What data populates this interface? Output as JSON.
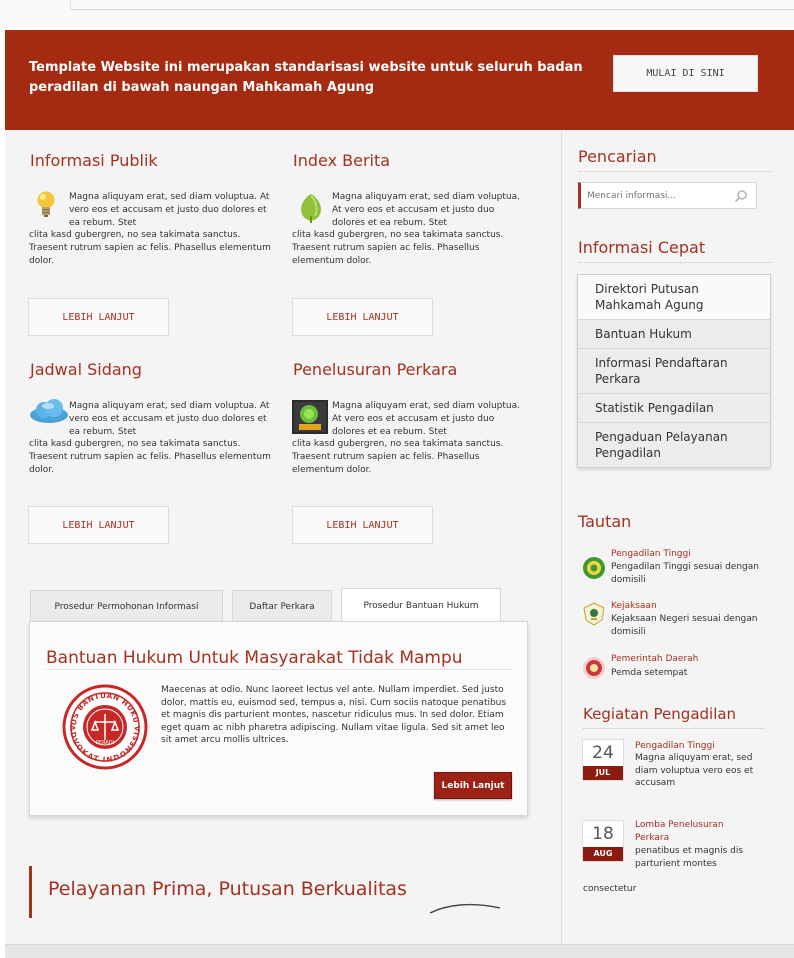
{
  "banner": {
    "text": "Template Website ini merupakan standarisasi website untuk seluruh badan peradilan di bawah naungan Mahkamah Agung",
    "button_label": "MULAI DI SINI"
  },
  "sections": [
    {
      "title": "Informasi Publik",
      "icon": "lightbulb-icon",
      "text_indent": "Magna aliquyam erat, sed diam voluptua. At vero eos et accusam et justo duo dolores et ea rebum. Stet",
      "text_rest": "clita kasd gubergren, no sea takimata sanctus. Traesent rutrum sapien ac felis. Phasellus elementum dolor.",
      "button_label": "LEBIH LANJUT"
    },
    {
      "title": "Index Berita",
      "icon": "leaf-icon",
      "text_indent": "Magna aliquyam erat, sed diam voluptua. At vero eos et accusam et justo duo dolores et ea rebum. Stet",
      "text_rest": "clita kasd gubergren, no sea takimata sanctus. Traesent rutrum sapien ac felis. Phasellus elementum dolor.",
      "button_label": "LEBIH LANJUT"
    },
    {
      "title": "Jadwal Sidang",
      "icon": "cloud-icon",
      "text_indent": "Magna aliquyam erat, sed diam voluptua. At vero eos et accusam et justo duo dolores et ea rebum. Stet",
      "text_rest": "clita kasd gubergren, no sea takimata sanctus. Traesent rutrum sapien ac felis. Phasellus elementum dolor.",
      "button_label": "LEBIH LANJUT"
    },
    {
      "title": "Penelusuran Perkara",
      "icon": "sipp-app-icon",
      "text_indent": "Magna aliquyam erat, sed diam voluptua. At vero eos et accusam et justo duo dolores et ea rebum. Stet",
      "text_rest": "clita kasd gubergren, no sea takimata sanctus. Traesent rutrum sapien ac felis. Phasellus elementum dolor.",
      "button_label": "LEBIH LANJUT"
    }
  ],
  "tabs": {
    "items": [
      "Prosedur Permohonan Informasi",
      "Daftar Perkara",
      "Prosedur Bantuan Hukum"
    ],
    "active_index": 2
  },
  "tab_panel": {
    "title": "Bantuan Hukum Untuk Masyarakat Tidak Mampu",
    "text": "Maecenas at odio. Nunc laoreet lectus vel ante. Nullam imperdiet. Sed justo dolor, mattis eu, euismod sed, tempus a, nisi. Cum sociis natoque penatibus et magnis dis parturient montes, nascetur ridiculus mus. In sed dolor. Etiam eget quam ac nibh pharetra adipiscing. Nullam vitae ligula. Sed sit amet leo sit amet arcu mollis ultrices.",
    "button_label": "Lebih Lanjut",
    "seal_text_top": "POS BANTUAN HUKUM",
    "seal_text_bottom": "ADVOKAT INDONESIA",
    "seal_center": "PERADI"
  },
  "tagline": "Pelayanan Prima, Putusan Berkualitas",
  "sidebar": {
    "search_title": "Pencarian",
    "search_placeholder": "Mencari informasi...",
    "quick_title": "Informasi Cepat",
    "quick_items": [
      "Direktori Putusan Mahkamah Agung",
      "Bantuan Hukum",
      "Informasi Pendaftaran Perkara",
      "Statistik Pengadilan",
      "Pengaduan Pelayanan Pengadilan"
    ],
    "links_title": "Tautan",
    "links": [
      {
        "title": "Pengadilan Tinggi",
        "desc": "Pengadilan Tinggi sesuai dengan domisili",
        "icon": "pengadilan-tinggi-logo-icon"
      },
      {
        "title": "Kejaksaan",
        "desc": "Kejaksaan Negeri sesuai dengan domisili",
        "icon": "kejaksaan-logo-icon"
      },
      {
        "title": "Pemerintah Daerah",
        "desc": "Pemda setempat",
        "icon": "pemda-logo-icon"
      }
    ],
    "events_title": "Kegiatan Pengadilan",
    "events": [
      {
        "day": "24",
        "month": "JUL",
        "title": "Pengadilan Tinggi",
        "desc": "Magna aliquyam erat, sed diam voluptua vero eos et accusam"
      },
      {
        "day": "18",
        "month": "AUG",
        "title": "Lomba Penelusuran Perkara",
        "desc": "penatibus et magnis dis parturient montes",
        "desc_tail": "consectetur"
      }
    ]
  },
  "colors": {
    "brand_red": "#a52a12",
    "title_red": "#a4311f",
    "background": "#f4f4f4"
  }
}
